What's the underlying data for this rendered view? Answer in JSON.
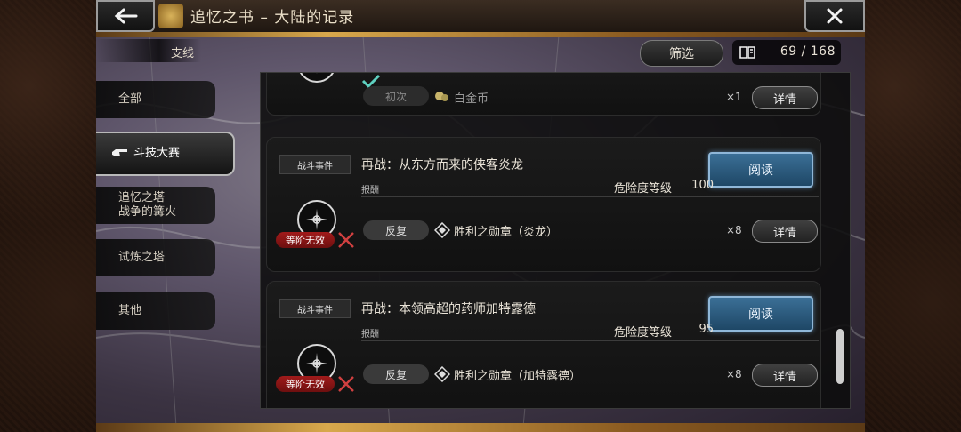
{
  "header": {
    "title": "追忆之书 – 大陆的记录",
    "back_icon": "arrow-left-icon",
    "close_icon": "close-icon"
  },
  "subtab": {
    "label": "支线"
  },
  "toolbar": {
    "filter_label": "筛选",
    "count": "69 / 168",
    "book_icon": "book-icon"
  },
  "sidebar": {
    "items": [
      {
        "label": "全部"
      },
      {
        "label": "斗技大赛",
        "active": true
      },
      {
        "label": "追忆之塔\n战争的篝火"
      },
      {
        "label": "试炼之塔"
      },
      {
        "label": "其他"
      }
    ]
  },
  "partial_card": {
    "first_label": "初次",
    "item_name": "白金币",
    "quantity": "×1",
    "detail_label": "详情"
  },
  "cards": [
    {
      "tag": "战斗事件",
      "title": "再战：从东方而来的侠客炎龙",
      "reward_label": "报酬",
      "danger_label": "危险度等级",
      "danger_value": "100",
      "read_label": "阅读",
      "rank_label": "等阶无效",
      "repeat_label": "反复",
      "item_name": "胜利之勋章（炎龙）",
      "quantity": "×8",
      "detail_label": "详情"
    },
    {
      "tag": "战斗事件",
      "title": "再战：本领高超的药师加特露德",
      "reward_label": "报酬",
      "danger_label": "危险度等级",
      "danger_value": "95",
      "read_label": "阅读",
      "rank_label": "等阶无效",
      "repeat_label": "反复",
      "item_name": "胜利之勋章（加特露德）",
      "quantity": "×8",
      "detail_label": "详情"
    }
  ],
  "colors": {
    "read_button": "#2f5f86",
    "rank_badge": "#8c1515",
    "gold_trim": "#d8a84c"
  }
}
